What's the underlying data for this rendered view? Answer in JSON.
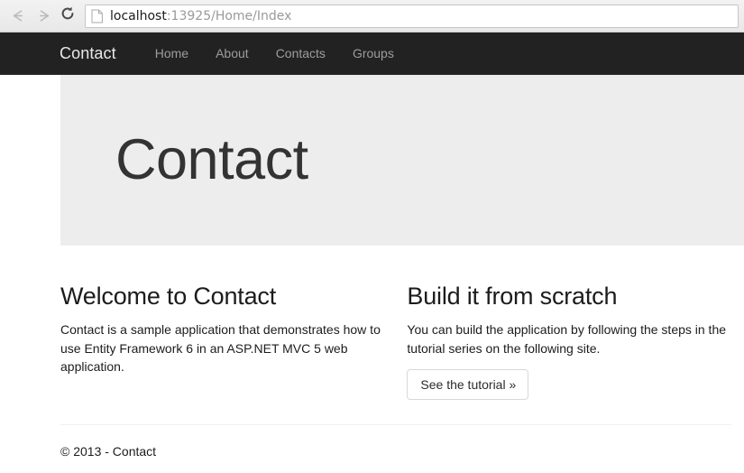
{
  "browser": {
    "back_icon": "back-arrow-icon",
    "forward_icon": "forward-arrow-icon",
    "reload_icon": "reload-icon",
    "favicon": "page-document-icon",
    "url_host": "localhost",
    "url_rest": ":13925/Home/Index",
    "url_full": "localhost:13925/Home/Index"
  },
  "navbar": {
    "brand": "Contact",
    "links": [
      {
        "label": "Home"
      },
      {
        "label": "About"
      },
      {
        "label": "Contacts"
      },
      {
        "label": "Groups"
      }
    ]
  },
  "jumbotron": {
    "heading": "Contact"
  },
  "columns": [
    {
      "heading": "Welcome to Contact",
      "body": "Contact is a sample application that demonstrates how to use Entity Framework 6 in an ASP.NET MVC 5 web application."
    },
    {
      "heading": "Build it from scratch",
      "body": "You can build the application by following the steps in the tutorial series on the following site.",
      "button_label": "See the tutorial »"
    }
  ],
  "footer": {
    "copyright": "© 2013 - Contact"
  },
  "colors": {
    "navbar_bg": "#222222",
    "jumbotron_bg": "#ededed",
    "brand_text": "#e8e8e8",
    "nav_link": "#9d9d9d",
    "heading_text": "#333333",
    "body_text": "#1c1c1c"
  }
}
